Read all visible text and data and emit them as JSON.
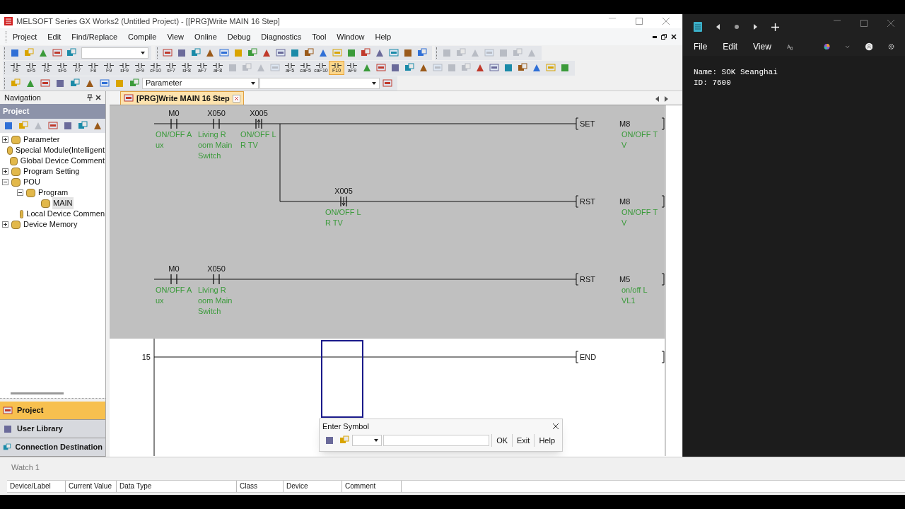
{
  "app": {
    "title": "MELSOFT Series GX Works2 (Untitled Project) - [[PRG]Write MAIN 16 Step]",
    "menu": [
      "Project",
      "Edit",
      "Find/Replace",
      "Compile",
      "View",
      "Online",
      "Debug",
      "Diagnostics",
      "Tool",
      "Window",
      "Help"
    ],
    "function_keys": [
      {
        "key": "F5",
        "selected": false
      },
      {
        "key": "sF5",
        "selected": false
      },
      {
        "key": "F6",
        "selected": false
      },
      {
        "key": "sF6",
        "selected": false
      },
      {
        "key": "F7",
        "selected": false
      },
      {
        "key": "F8",
        "selected": false
      },
      {
        "key": "F9",
        "selected": false
      },
      {
        "key": "sF9",
        "selected": false
      },
      {
        "key": "cF9",
        "selected": false
      },
      {
        "key": "cF10",
        "selected": false
      },
      {
        "key": "sF7",
        "selected": false
      },
      {
        "key": "sF8",
        "selected": false
      },
      {
        "key": "aF7",
        "selected": false
      },
      {
        "key": "aF8",
        "selected": false
      }
    ],
    "function_keys_2": [
      {
        "key": "aF5",
        "selected": false
      },
      {
        "key": "caF5",
        "selected": false
      },
      {
        "key": "caF10",
        "selected": false
      },
      {
        "key": "F10",
        "selected": true
      },
      {
        "key": "aF9",
        "selected": false
      }
    ],
    "target_combo": {
      "value": "Parameter"
    }
  },
  "navigation": {
    "title": "Navigation",
    "section": "Project",
    "tree": [
      {
        "label": "Parameter",
        "expanded": false,
        "selected": false
      },
      {
        "label": "Special Module(Intelligent",
        "selected": false
      },
      {
        "label": "Global Device Comment",
        "selected": false
      },
      {
        "label": "Program Setting",
        "expanded": false,
        "selected": false
      },
      {
        "label": "POU",
        "expanded": true,
        "selected": false,
        "children": [
          {
            "label": "Program",
            "expanded": true,
            "selected": false,
            "children": [
              {
                "label": "MAIN",
                "selected": true
              }
            ]
          },
          {
            "label": "Local Device Commen",
            "selected": false
          }
        ]
      },
      {
        "label": "Device Memory",
        "expanded": false,
        "selected": false
      }
    ],
    "bottom_tabs": [
      {
        "label": "Project",
        "selected": true
      },
      {
        "label": "User Library",
        "selected": false
      },
      {
        "label": "Connection Destination",
        "selected": false
      }
    ]
  },
  "editor": {
    "tab": {
      "label": "[PRG]Write MAIN 16 Step",
      "selected": true
    },
    "rungs": [
      {
        "shaded": true,
        "cursor": false,
        "contacts": [
          {
            "kind": "normally_open",
            "device": "M0",
            "comment": [
              "ON/OFF A",
              "ux"
            ]
          },
          {
            "kind": "normally_open",
            "device": "X050",
            "comment": [
              "Living R",
              "oom Main",
              "Switch"
            ]
          },
          {
            "kind": "rising_edge",
            "device": "X005",
            "comment": [
              "ON/OFF L",
              "R TV"
            ]
          }
        ],
        "instruction": {
          "op": "SET",
          "device": "M8",
          "comment": [
            "ON/OFF T",
            "V"
          ]
        },
        "branch": {
          "contacts": [
            {
              "kind": "falling_edge",
              "device": "X005",
              "comment": [
                "ON/OFF L",
                "R TV"
              ]
            }
          ],
          "instruction": {
            "op": "RST",
            "device": "M8",
            "comment": [
              "ON/OFF T",
              "V"
            ]
          }
        }
      },
      {
        "shaded": true,
        "cursor": false,
        "contacts": [
          {
            "kind": "normally_open",
            "device": "M0",
            "comment": [
              "ON/OFF A",
              "ux"
            ]
          },
          {
            "kind": "normally_open",
            "device": "X050",
            "comment": [
              "Living R",
              "oom Main",
              "Switch"
            ]
          }
        ],
        "instruction": {
          "op": "RST",
          "device": "M5",
          "comment": [
            "on/off L",
            "VL1"
          ]
        }
      },
      {
        "shaded": false,
        "cursor": true,
        "step": "15",
        "instruction": {
          "op": "END"
        }
      }
    ]
  },
  "dialog": {
    "title": "Enter Symbol",
    "buttons": [
      "OK",
      "Exit",
      "Help"
    ]
  },
  "watch": {
    "tab": "Watch 1",
    "columns": [
      "Device/Label",
      "Current Value",
      "Data Type",
      "Class",
      "Device",
      "Comment"
    ]
  },
  "notepad": {
    "menu": [
      "File",
      "Edit",
      "View"
    ],
    "lines": [
      "Name: SOK Seanghai",
      "ID: 7600"
    ]
  }
}
